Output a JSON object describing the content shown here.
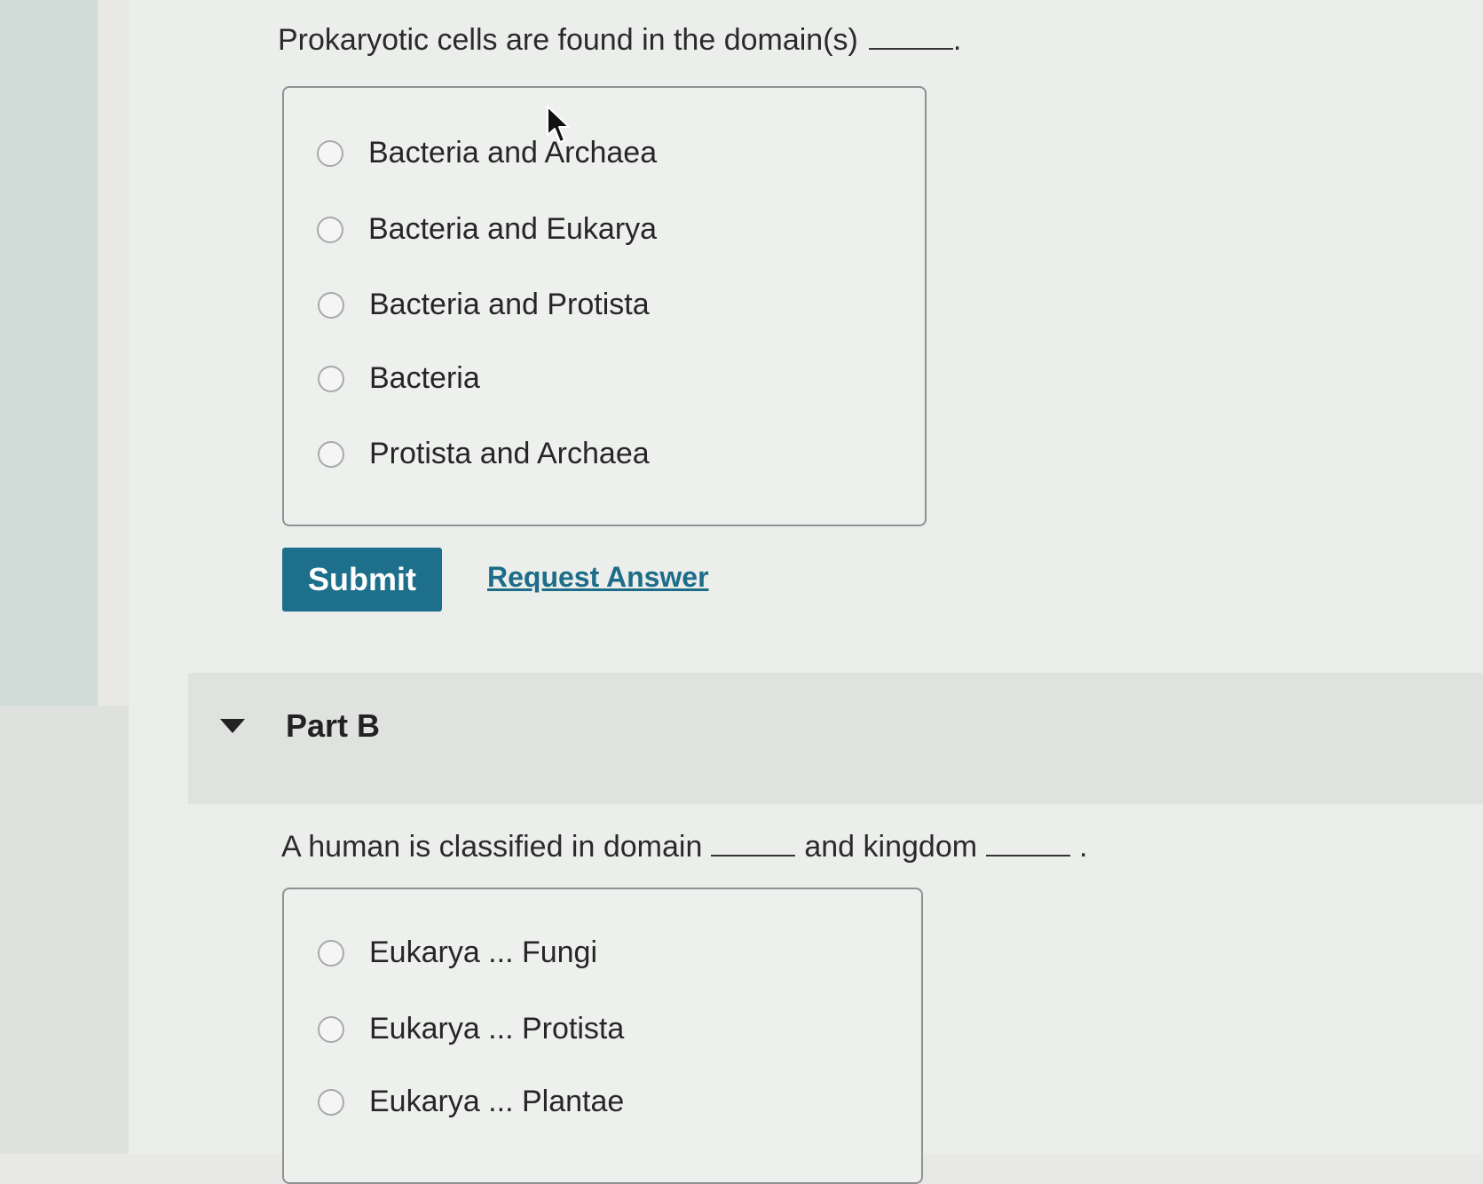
{
  "partA": {
    "question_text": "Prokaryotic cells are found in the domain(s)",
    "question_end": ".",
    "options": [
      "Bacteria and Archaea",
      "Bacteria and Eukarya",
      "Bacteria and Protista",
      "Bacteria",
      "Protista and Archaea"
    ],
    "submit_label": "Submit",
    "request_answer_label": "Request Answer"
  },
  "partB": {
    "title": "Part B",
    "question_start": "A human is classified in domain",
    "question_mid": "and kingdom",
    "question_end": ".",
    "options": [
      "Eukarya ... Fungi",
      "Eukarya ... Protista",
      "Eukarya ... Plantae"
    ]
  },
  "colors": {
    "accent": "#1e6f8c",
    "link": "#1d6c88"
  }
}
